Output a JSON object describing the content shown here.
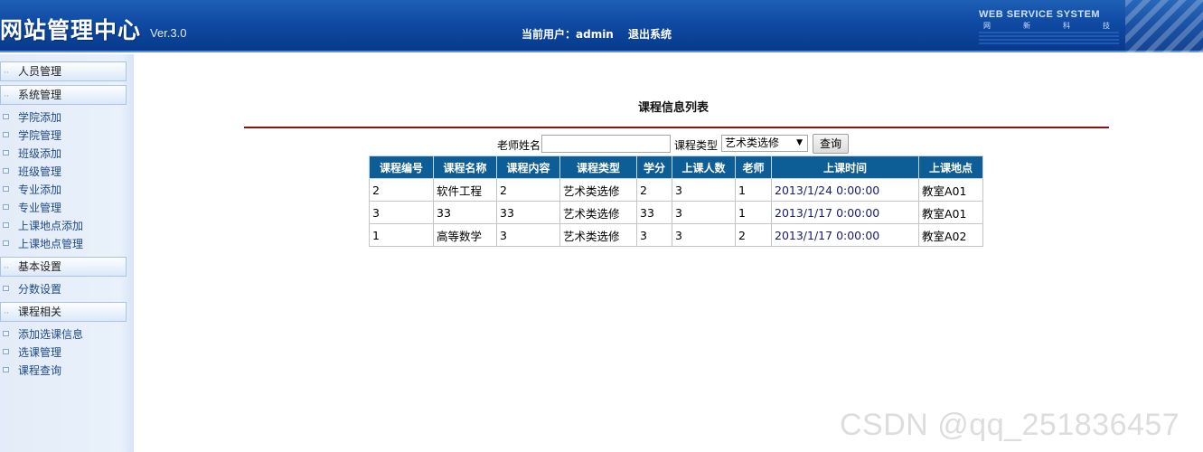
{
  "header": {
    "title": "网站管理中心",
    "version": "Ver.3.0",
    "current_user_label": "当前用户：admin",
    "logout_label": "退出系统",
    "brand": "WEB SERVICE SYSTEM",
    "brand_sub": [
      "网",
      "新",
      "科",
      "技"
    ]
  },
  "sidebar": {
    "sections": [
      {
        "label": "人员管理",
        "items": []
      },
      {
        "label": "系统管理",
        "items": [
          "学院添加",
          "学院管理",
          "班级添加",
          "班级管理",
          "专业添加",
          "专业管理",
          "上课地点添加",
          "上课地点管理"
        ]
      },
      {
        "label": "基本设置",
        "items": [
          "分数设置"
        ]
      },
      {
        "label": "课程相关",
        "items": [
          "添加选课信息",
          "选课管理",
          "课程查询"
        ]
      }
    ]
  },
  "main": {
    "page_title": "课程信息列表",
    "search": {
      "teacher_label": "老师姓名",
      "teacher_value": "",
      "type_label": "课程类型",
      "type_selected": "艺术类选修",
      "query_button": "查询"
    },
    "table": {
      "headers": [
        "课程编号",
        "课程名称",
        "课程内容",
        "课程类型",
        "学分",
        "上课人数",
        "老师",
        "上课时间",
        "上课地点"
      ],
      "rows": [
        [
          "2",
          "软件工程",
          "2",
          "艺术类选修",
          "2",
          "3",
          "1",
          "2013/1/24 0:00:00",
          "教室A01"
        ],
        [
          "3",
          "33",
          "33",
          "艺术类选修",
          "33",
          "3",
          "1",
          "2013/1/17 0:00:00",
          "教室A01"
        ],
        [
          "1",
          "高等数学",
          "3",
          "艺术类选修",
          "3",
          "3",
          "2",
          "2013/1/17 0:00:00",
          "教室A02"
        ]
      ]
    }
  },
  "watermark": "CSDN @qq_251836457",
  "colors": {
    "header_blue": "#0f4aa3",
    "table_header": "#0d5d96",
    "title_rule": "#8b1010"
  }
}
